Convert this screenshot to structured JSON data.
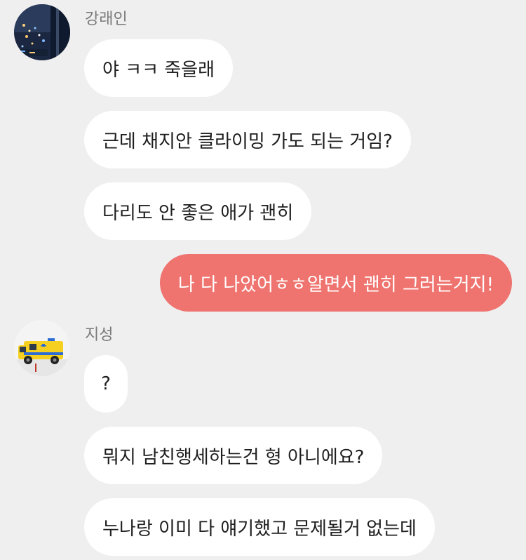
{
  "colors": {
    "background": "#efefef",
    "incoming_bubble": "#ffffff",
    "outgoing_bubble": "#ef736e",
    "sender_name": "#7a7a7a"
  },
  "messages": [
    {
      "sender": "강래인",
      "avatar": "night-city-avatar",
      "bubbles": [
        "야 ㅋㅋ 죽을래",
        "근데  채지안 클라이밍 가도 되는 거임?",
        "다리도 안 좋은 애가 괜히"
      ]
    },
    {
      "sender": "me",
      "bubbles": [
        "나 다 나았어ㅎㅎ알면서 괜히 그러는거지!"
      ]
    },
    {
      "sender": "지성",
      "avatar": "toy-ambulance-avatar",
      "bubbles": [
        "?",
        "뭐지 남친행세하는건 형 아니에요?",
        "누나랑 이미 다 얘기했고 문제될거 없는데"
      ]
    }
  ]
}
